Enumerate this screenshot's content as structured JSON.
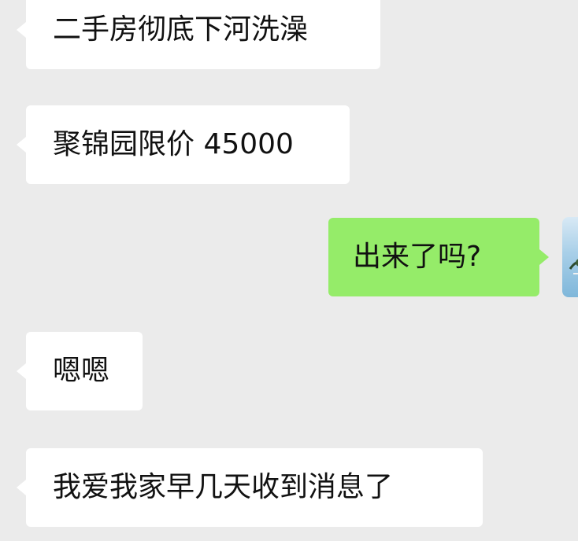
{
  "messages": [
    {
      "side": "incoming",
      "text": "二手房彻底下河洗澡"
    },
    {
      "side": "incoming",
      "text": "聚锦园限价 45000"
    },
    {
      "side": "outgoing",
      "text": "出来了吗?"
    },
    {
      "side": "incoming",
      "text": "嗯嗯"
    },
    {
      "side": "incoming",
      "text": "我爱我家早几天收到消息了"
    }
  ],
  "colors": {
    "background": "#ebebeb",
    "incoming_bubble": "#ffffff",
    "outgoing_bubble": "#95ec69",
    "text": "#111111"
  },
  "avatar": {
    "icon": "user-avatar-photo"
  }
}
